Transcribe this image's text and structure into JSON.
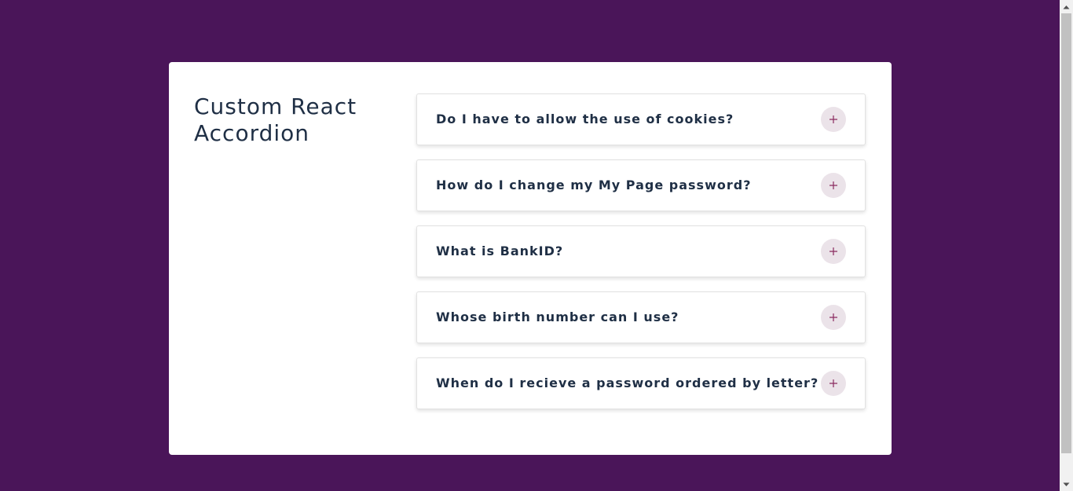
{
  "page": {
    "title": "Custom React Accordion"
  },
  "accordion": {
    "items": [
      {
        "question": "Do I have to allow the use of cookies?",
        "icon": "plus-icon"
      },
      {
        "question": "How do I change my My Page password?",
        "icon": "plus-icon"
      },
      {
        "question": "What is BankID?",
        "icon": "plus-icon"
      },
      {
        "question": "Whose birth number can I use?",
        "icon": "plus-icon"
      },
      {
        "question": "When do I recieve a password ordered by letter?",
        "icon": "plus-icon"
      }
    ]
  },
  "colors": {
    "background": "#4a1559",
    "card": "#ffffff",
    "text": "#1f2f45",
    "toggle_bg": "#ebe3e9",
    "toggle_icon": "#8a2a5f"
  }
}
